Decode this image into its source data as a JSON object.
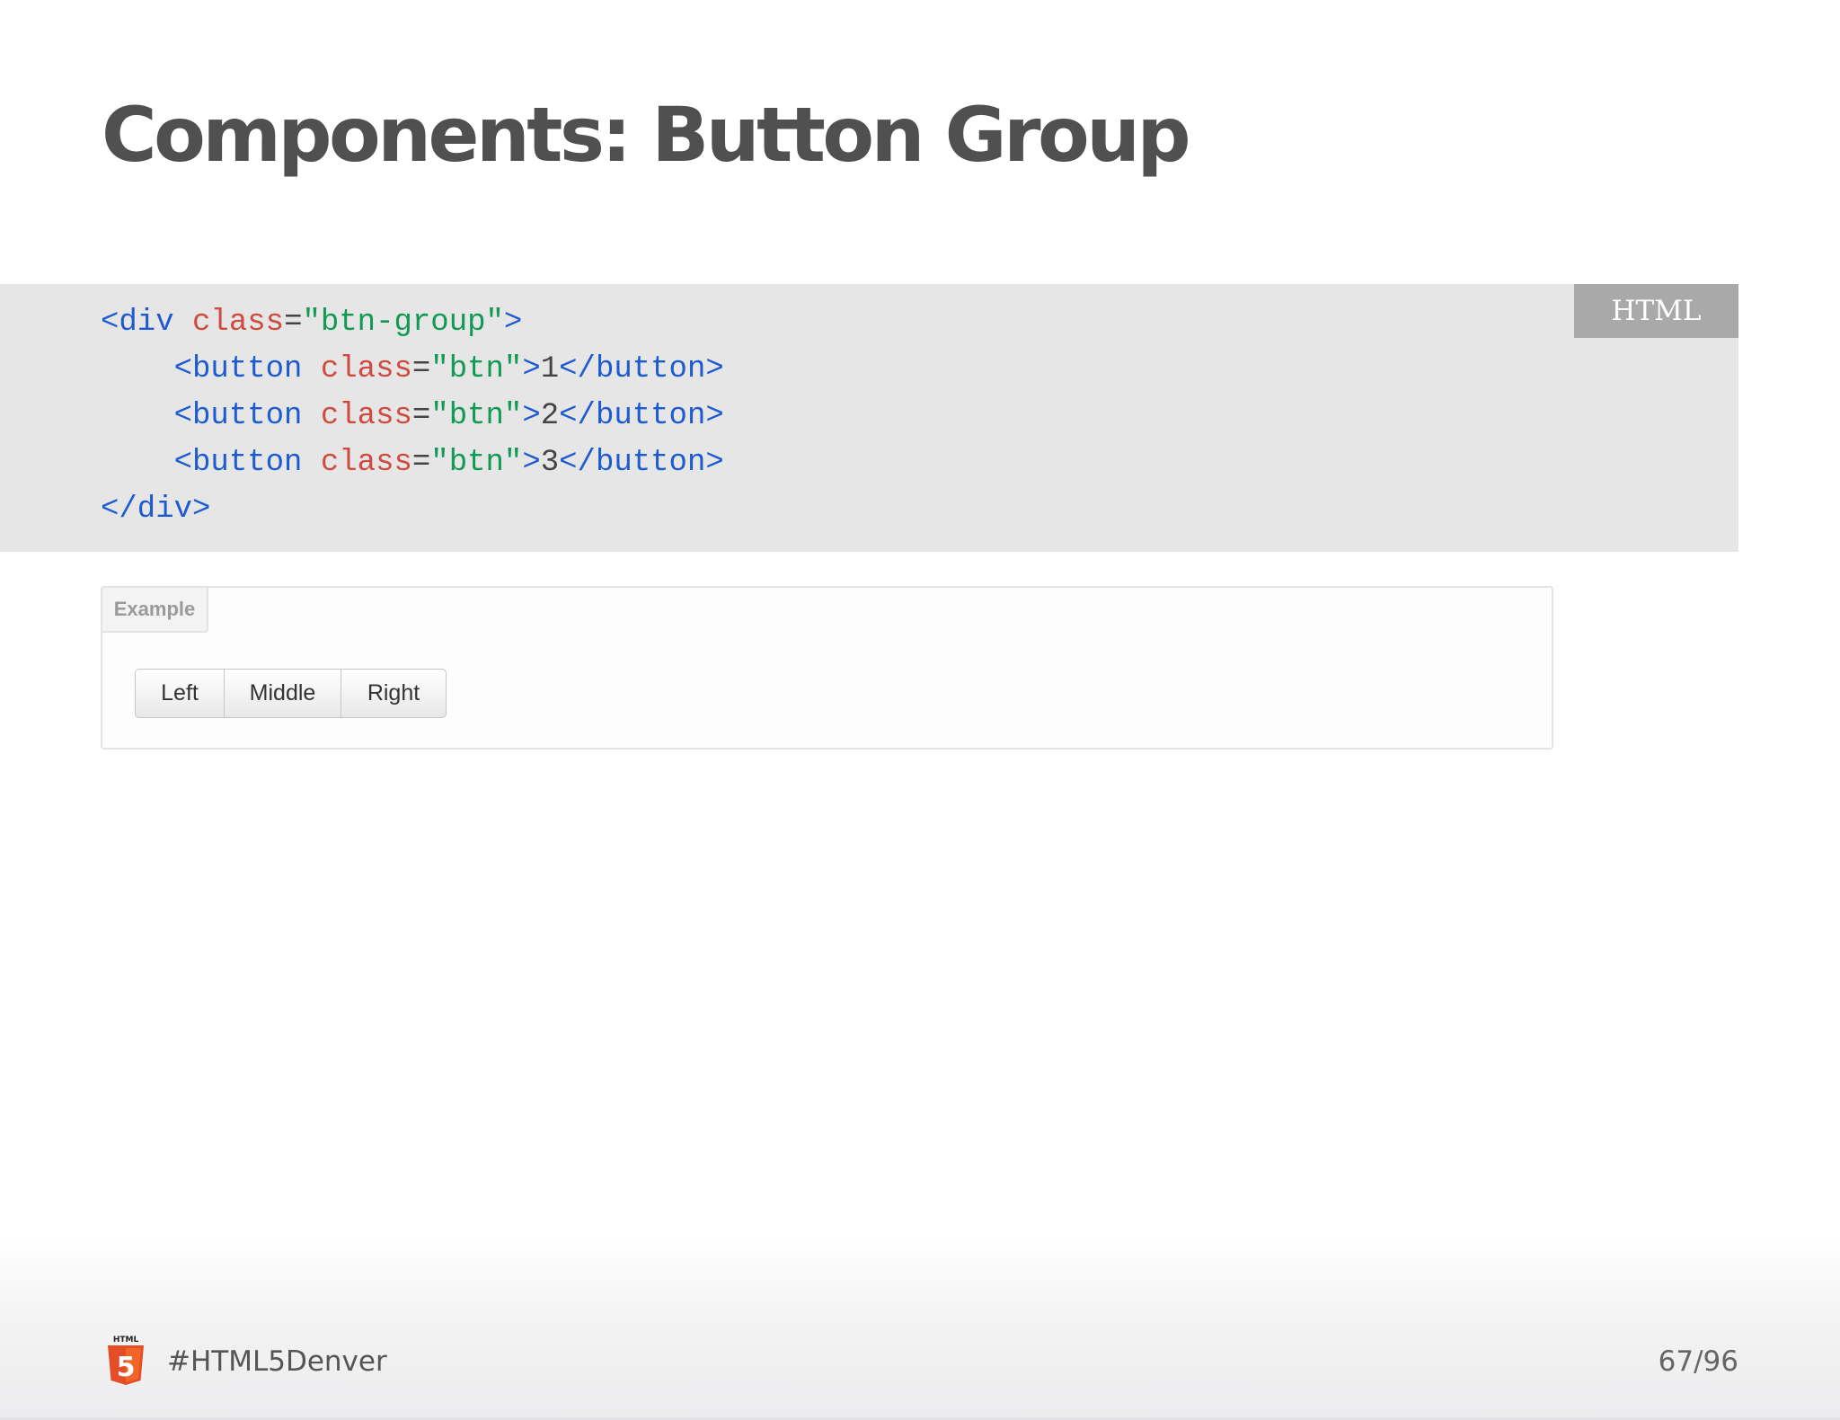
{
  "slide": {
    "title": "Components: Button Group"
  },
  "code_block": {
    "language_label": "HTML",
    "lines": [
      [
        {
          "t": "tag",
          "v": "<div "
        },
        {
          "t": "attr",
          "v": "class"
        },
        {
          "t": "pun",
          "v": "="
        },
        {
          "t": "str",
          "v": "\"btn-group\""
        },
        {
          "t": "tag",
          "v": ">"
        }
      ],
      [
        {
          "t": "pun",
          "v": "    "
        },
        {
          "t": "tag",
          "v": "<button "
        },
        {
          "t": "attr",
          "v": "class"
        },
        {
          "t": "pun",
          "v": "="
        },
        {
          "t": "str",
          "v": "\"btn\""
        },
        {
          "t": "tag",
          "v": ">"
        },
        {
          "t": "pun",
          "v": "1"
        },
        {
          "t": "tag",
          "v": "</button>"
        }
      ],
      [
        {
          "t": "pun",
          "v": "    "
        },
        {
          "t": "tag",
          "v": "<button "
        },
        {
          "t": "attr",
          "v": "class"
        },
        {
          "t": "pun",
          "v": "="
        },
        {
          "t": "str",
          "v": "\"btn\""
        },
        {
          "t": "tag",
          "v": ">"
        },
        {
          "t": "pun",
          "v": "2"
        },
        {
          "t": "tag",
          "v": "</button>"
        }
      ],
      [
        {
          "t": "pun",
          "v": "    "
        },
        {
          "t": "tag",
          "v": "<button "
        },
        {
          "t": "attr",
          "v": "class"
        },
        {
          "t": "pun",
          "v": "="
        },
        {
          "t": "str",
          "v": "\"btn\""
        },
        {
          "t": "tag",
          "v": ">"
        },
        {
          "t": "pun",
          "v": "3"
        },
        {
          "t": "tag",
          "v": "</button>"
        }
      ],
      [
        {
          "t": "tag",
          "v": "</div>"
        }
      ]
    ]
  },
  "example": {
    "label": "Example",
    "buttons": [
      {
        "label": "Left"
      },
      {
        "label": "Middle"
      },
      {
        "label": "Right"
      }
    ]
  },
  "footer": {
    "logo_text": "HTML",
    "logo_number": "5",
    "hashtag": "#HTML5Denver",
    "page_indicator": "67/96"
  },
  "colors": {
    "title": "#505050",
    "code_background": "#e6e6e7",
    "code_tag": "#1d5bd0",
    "code_attr": "#d14a3e",
    "code_string": "#119a53",
    "language_badge": "#a9a9a9",
    "html5_orange": "#e44d26"
  }
}
